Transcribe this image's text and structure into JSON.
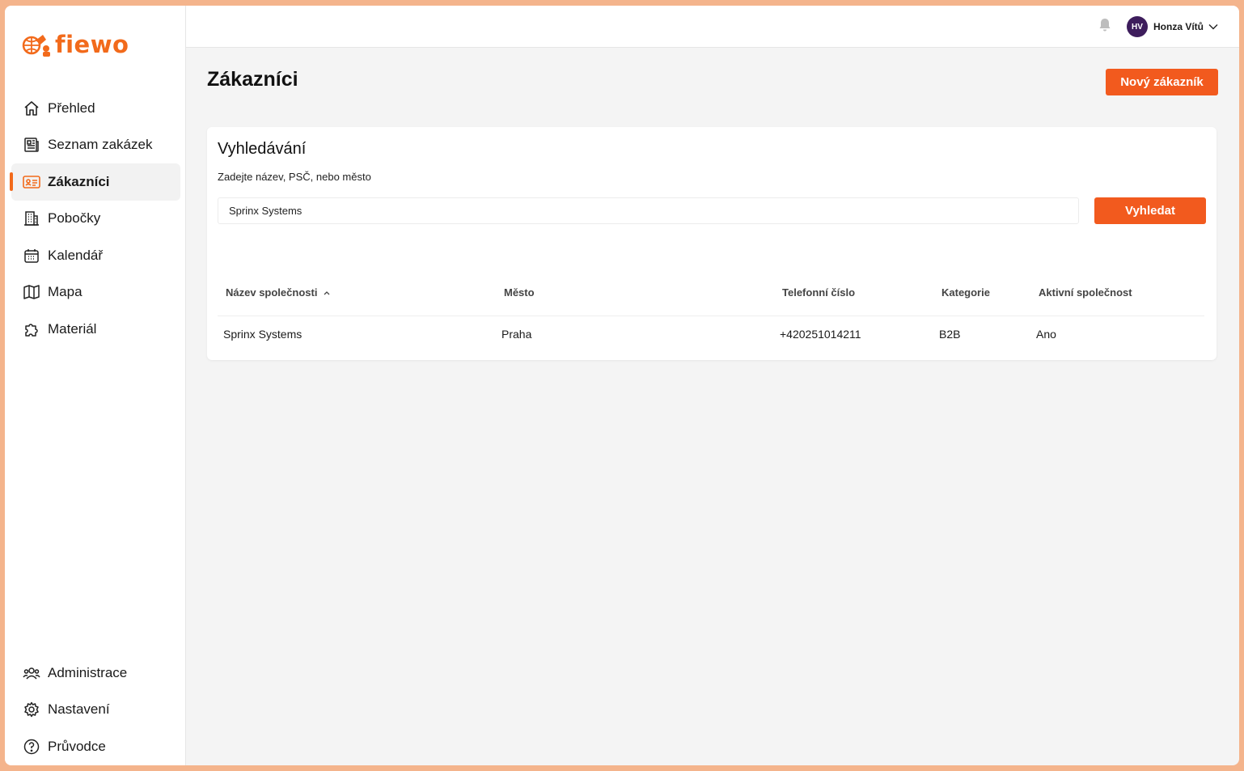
{
  "brand": {
    "name": "fiewo",
    "color": "#f26a1b"
  },
  "sidebar": {
    "items": [
      {
        "label": "Přehled",
        "icon": "home-icon"
      },
      {
        "label": "Seznam zakázek",
        "icon": "newspaper-icon"
      },
      {
        "label": "Zákazníci",
        "icon": "id-card-icon",
        "active": true
      },
      {
        "label": "Pobočky",
        "icon": "building-icon"
      },
      {
        "label": "Kalendář",
        "icon": "calendar-icon"
      },
      {
        "label": "Mapa",
        "icon": "map-icon"
      },
      {
        "label": "Materiál",
        "icon": "puzzle-icon"
      }
    ],
    "bottom_items": [
      {
        "label": "Administrace",
        "icon": "users-icon"
      },
      {
        "label": "Nastavení",
        "icon": "gear-icon"
      },
      {
        "label": "Průvodce",
        "icon": "help-circle-icon"
      }
    ]
  },
  "topbar": {
    "user": {
      "initials": "HV",
      "name": "Honza Vítů",
      "avatar_color": "#3d1d5c"
    }
  },
  "page": {
    "title": "Zákazníci",
    "new_button": "Nový zákazník"
  },
  "search": {
    "title": "Vyhledávání",
    "hint": "Zadejte název, PSČ, nebo město",
    "value": "Sprinx Systems",
    "button": "Vyhledat"
  },
  "table": {
    "columns": [
      "Název společnosti",
      "Město",
      "Telefonní číslo",
      "Kategorie",
      "Aktivní společnost"
    ],
    "rows": [
      [
        "Sprinx Systems",
        "Praha",
        "+420251014211",
        "B2B",
        "Ano"
      ]
    ]
  },
  "colors": {
    "accent": "#f25a1e",
    "background": "#f4f4f4"
  }
}
